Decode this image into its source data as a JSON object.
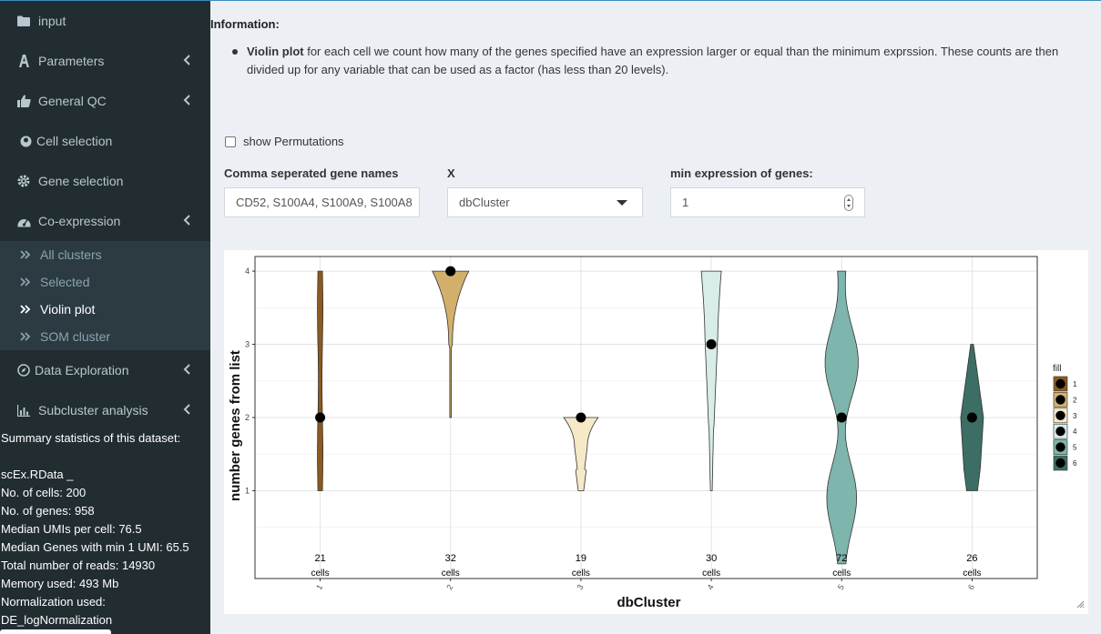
{
  "sidebar": {
    "items": [
      {
        "label": "input",
        "icon": "folder-icon"
      },
      {
        "label": "Parameters",
        "icon": "sliders-icon",
        "chevron": true
      },
      {
        "label": "General QC",
        "icon": "thumbs-up-icon",
        "chevron": true
      },
      {
        "label": "Cell selection",
        "icon": "circle-icon"
      },
      {
        "label": "Gene selection",
        "icon": "gear-icon"
      },
      {
        "label": "Co-expression",
        "icon": "dashboard-icon",
        "chevron": true
      }
    ],
    "coexpression_subitems": [
      "All clusters",
      "Selected",
      "Violin plot",
      "SOM cluster"
    ],
    "items_after": [
      {
        "label": "Data Exploration",
        "icon": "compass-icon",
        "chevron": true
      },
      {
        "label": "Subcluster analysis",
        "icon": "bar-chart-icon",
        "chevron": true
      }
    ],
    "stats_title": "Summary statistics of this dataset:",
    "stats": [
      "scEx.RData _",
      "No. of cells: 200",
      "No. of genes: 958",
      "Median UMIs per cell: 76.5",
      "Median Genes with min 1 UMI: 65.5",
      "Total number of reads: 14930",
      "Memory used: 493 Mb",
      "Normalization used:",
      "DE_logNormalization"
    ]
  },
  "main": {
    "info_title": "Information:",
    "info_bold": "Violin plot",
    "info_text": " for each cell we count how many of the genes specified have an expression larger or equal than the minimum exprssion. These counts are then divided up for any variable that can be used as a factor (has less than 20 levels).",
    "show_permutations_label": "show Permutations",
    "gene_names_label": "Comma seperated gene names",
    "gene_names_value": "CD52, S100A4, S100A9, S100A8",
    "x_label": "X",
    "x_value": "dbCluster",
    "min_expr_label": "min expression of genes:",
    "min_expr_value": "1"
  },
  "chart_data": {
    "type": "violin",
    "xlabel": "dbCluster",
    "ylabel": "number genes from list",
    "ylim": [
      -0.2,
      4.2
    ],
    "yticks": [
      1,
      2,
      3,
      4
    ],
    "grid": true,
    "legend_title": "fill",
    "legend_position": "right",
    "cell_word": "cells",
    "categories": [
      "1",
      "2",
      "3",
      "4",
      "5",
      "6"
    ],
    "counts": [
      21,
      32,
      19,
      30,
      72,
      26
    ],
    "medians": [
      2,
      4,
      2,
      3,
      2,
      2
    ],
    "ranges": [
      [
        1,
        4
      ],
      [
        2,
        4
      ],
      [
        1,
        2
      ],
      [
        1,
        4
      ],
      [
        0,
        4
      ],
      [
        1,
        3
      ]
    ],
    "colors": [
      "#8c5a1e",
      "#d2b06c",
      "#f5e9c8",
      "#d8ece8",
      "#7eb5ad",
      "#3c6e65"
    ]
  }
}
